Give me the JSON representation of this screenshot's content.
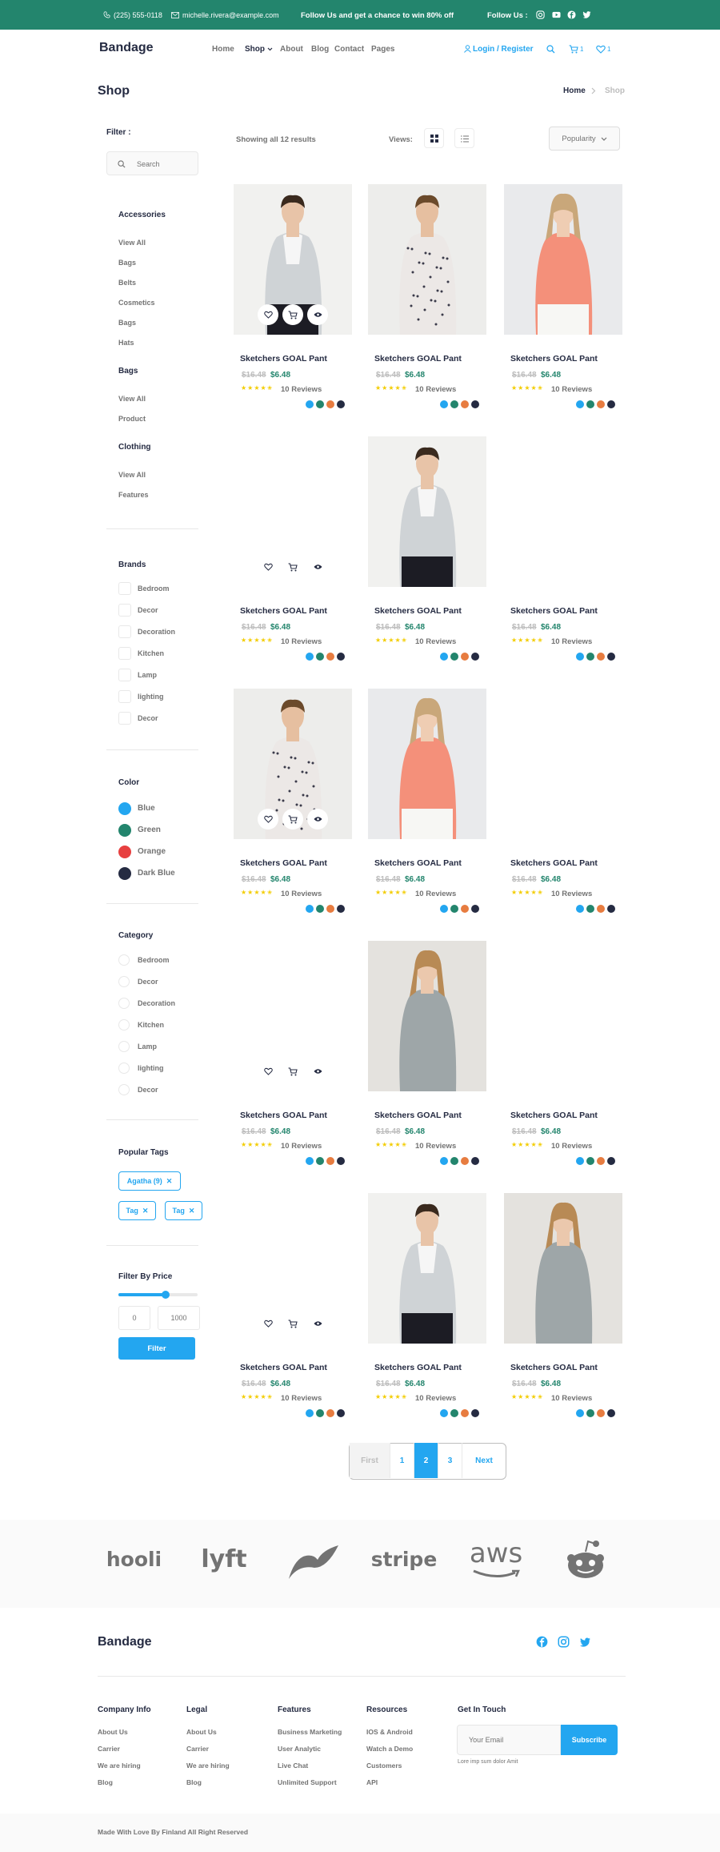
{
  "topbar": {
    "phone": "(225) 555-0118",
    "email": "michelle.rivera@example.com",
    "promo": "Follow Us  and get a chance to win 80% off",
    "follow": "Follow Us  :"
  },
  "brand": "Bandage",
  "nav": {
    "home": "Home",
    "shop": "Shop",
    "about": "About",
    "blog": "Blog",
    "contact": "Contact",
    "pages": "Pages"
  },
  "account": {
    "login": "Login / Register",
    "cart_count": "1",
    "wish_count": "1"
  },
  "page": {
    "title": "Shop",
    "breadcrumb_home": "Home",
    "breadcrumb_current": "Shop"
  },
  "filter": {
    "label": "Filter :",
    "search_placeholder": "Search"
  },
  "toolbar": {
    "results": "Showing all 12 results",
    "views_label": "Views:",
    "sort": "Popularity"
  },
  "sidebar": {
    "groups": [
      {
        "title": "Accessories",
        "items": [
          "View All",
          "Bags",
          "Belts",
          "Cosmetics",
          "Bags",
          "Hats"
        ]
      },
      {
        "title": "Bags",
        "items": [
          "View All",
          "Product"
        ]
      },
      {
        "title": "Clothing",
        "items": [
          "View All",
          "Features"
        ]
      }
    ],
    "brands_title": "Brands",
    "brands": [
      "Bedroom",
      "Decor",
      "Decoration",
      "Kitchen",
      "Lamp",
      "lighting",
      "Decor"
    ],
    "color_title": "Color",
    "colors": [
      {
        "name": "Blue",
        "hex": "#23a6f0"
      },
      {
        "name": "Green",
        "hex": "#23856d"
      },
      {
        "name": "Orange",
        "hex": "#e74040"
      },
      {
        "name": "Dark Blue",
        "hex": "#252b42"
      }
    ],
    "category_title": "Category",
    "categories": [
      "Bedroom",
      "Decor",
      "Decoration",
      "Kitchen",
      "Lamp",
      "lighting",
      "Decor"
    ],
    "tags_title": "Popular Tags",
    "tags": [
      "Agatha (9)",
      "Tag",
      "Tag"
    ],
    "price_title": "Filter By Price",
    "price_min": "0",
    "price_max": "1000",
    "price_button": "Filter"
  },
  "product": {
    "title": "Sketchers GOAL Pant",
    "old_price": "$16.48",
    "new_price": "$6.48",
    "reviews": "10 Reviews",
    "rating": 4.5,
    "swatches": [
      "#23a6f0",
      "#23856d",
      "#e77c40",
      "#252b42"
    ]
  },
  "pagination": {
    "first": "First",
    "p1": "1",
    "p2": "2",
    "p3": "3",
    "next": "Next"
  },
  "brands_bar": [
    "hooli",
    "lyft",
    "leaf",
    "stripe",
    "aws",
    "reddit"
  ],
  "footer": {
    "brand": "Bandage",
    "columns": [
      {
        "title": "Company Info",
        "links": [
          "About Us",
          "Carrier",
          "We are hiring",
          "Blog"
        ]
      },
      {
        "title": "Legal",
        "links": [
          "About Us",
          "Carrier",
          "We are hiring",
          "Blog"
        ]
      },
      {
        "title": "Features",
        "links": [
          "Business Marketing",
          "User Analytic",
          "Live Chat",
          "Unlimited Support"
        ]
      },
      {
        "title": "Resources",
        "links": [
          "IOS & Android",
          "Watch a Demo",
          "Customers",
          "API"
        ]
      }
    ],
    "touch_title": "Get In Touch",
    "email_placeholder": "Your Email",
    "subscribe": "Subscribe",
    "note": "Lore imp sum dolor Amit",
    "copyright": "Made With Love By Finland All Right Reserved"
  },
  "colors": {
    "accent": "#23a6f0",
    "green": "#23856d",
    "dark": "#252b42",
    "muted": "#737373"
  }
}
